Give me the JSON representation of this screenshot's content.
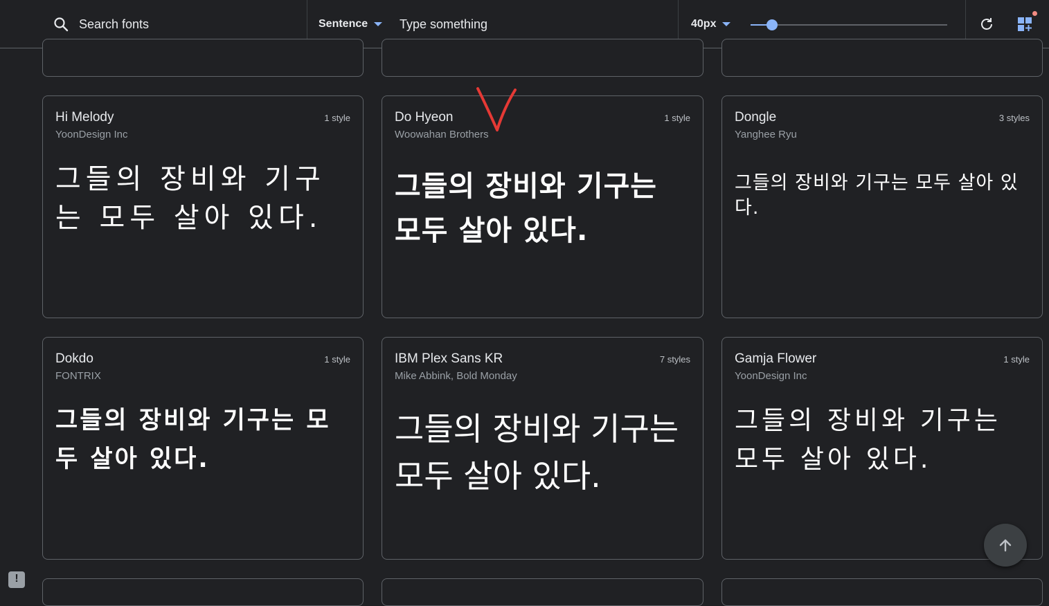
{
  "toolbar": {
    "search_placeholder": "Search fonts",
    "preview_mode": "Sentence",
    "preview_text_placeholder": "Type something",
    "font_size_label": "40px",
    "font_size_slider_percent": 11
  },
  "colors": {
    "accent": "#8ab4f8",
    "background": "#202124",
    "border": "#5f6368",
    "annotation": "#e53935",
    "badge": "#f28b82"
  },
  "cards": [
    {
      "name": "Hi Melody",
      "designer": "YoonDesign Inc",
      "styles": "1 style",
      "sample": "그들의 장비와 기구는 모두 살아 있다."
    },
    {
      "name": "Do Hyeon",
      "designer": "Woowahan Brothers",
      "styles": "1 style",
      "sample": "그들의 장비와 기구는 모두 살아 있다."
    },
    {
      "name": "Dongle",
      "designer": "Yanghee Ryu",
      "styles": "3 styles",
      "sample": "그들의 장비와 기구는 모두 살아 있다."
    },
    {
      "name": "Dokdo",
      "designer": "FONTRIX",
      "styles": "1 style",
      "sample": "그들의 장비와 기구는 모두 살아 있다."
    },
    {
      "name": "IBM Plex Sans KR",
      "designer": "Mike Abbink, Bold Monday",
      "styles": "7 styles",
      "sample": "그들의 장비와 기구는 모두 살아 있다."
    },
    {
      "name": "Gamja Flower",
      "designer": "YoonDesign Inc",
      "styles": "1 style",
      "sample": "그들의 장비와 기구는 모두 살아 있다."
    }
  ],
  "icons": {
    "search": "search-icon",
    "dropdown": "chevron-down-icon",
    "refresh": "refresh-icon",
    "grid": "grid-icon",
    "scroll_top": "arrow-up-icon",
    "feedback": "feedback-icon"
  },
  "feedback_label": "!"
}
